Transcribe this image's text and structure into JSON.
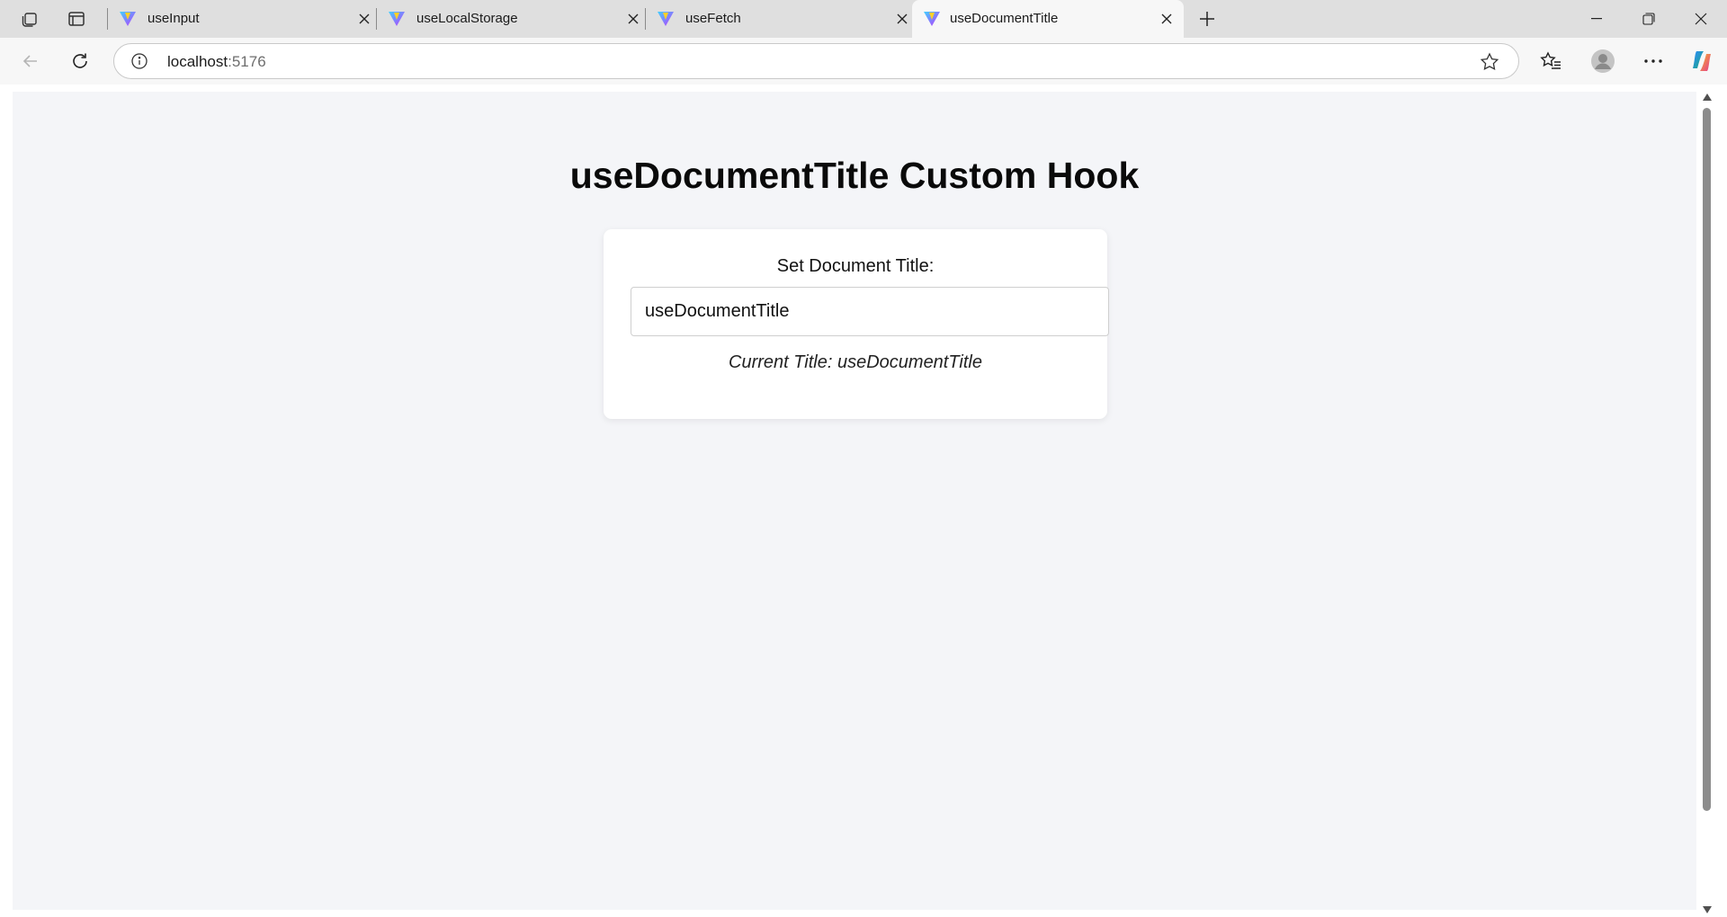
{
  "browser": {
    "tabs": [
      {
        "title": "useInput",
        "active": false
      },
      {
        "title": "useLocalStorage",
        "active": false
      },
      {
        "title": "useFetch",
        "active": false
      },
      {
        "title": "useDocumentTitle",
        "active": true
      }
    ],
    "address": {
      "host": "localhost",
      "port": ":5176"
    },
    "icons": {
      "workspaces": "workspaces-icon",
      "vertical_tabs": "vertical-tabs-icon",
      "favicon": "vite-logo-icon",
      "close": "close-icon",
      "new_tab": "plus-icon",
      "minimize": "minimize-icon",
      "restore": "restore-icon",
      "close_window": "close-window-icon",
      "back": "back-arrow-icon",
      "refresh": "refresh-icon",
      "site_info": "info-icon",
      "favorite": "star-icon",
      "favorites": "favorites-list-icon",
      "profile": "profile-avatar-icon",
      "more": "more-dots-icon",
      "copilot": "copilot-icon"
    }
  },
  "page": {
    "heading": "useDocumentTitle Custom Hook",
    "card": {
      "label": "Set Document Title:",
      "input_value": "useDocumentTitle",
      "current_title_text": "Current Title: useDocumentTitle"
    }
  }
}
